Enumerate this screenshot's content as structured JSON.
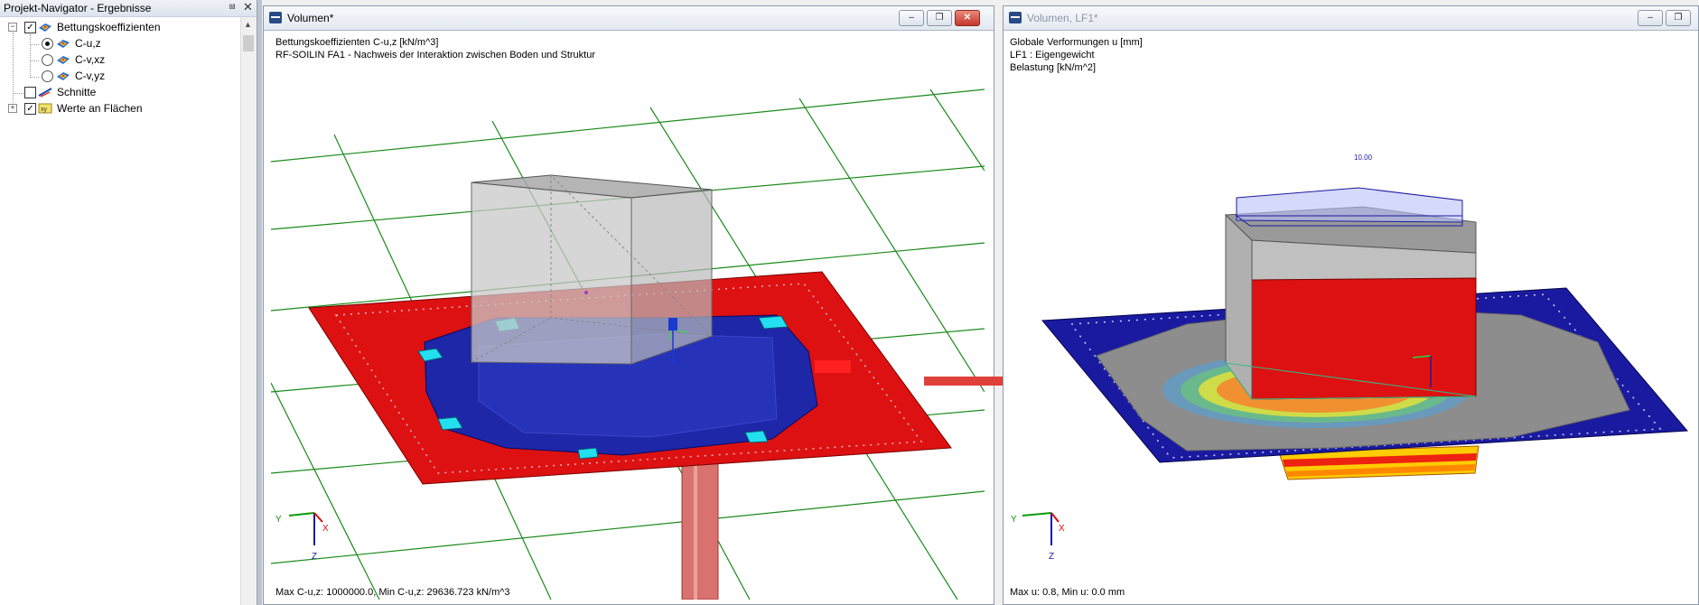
{
  "navigator": {
    "title": "Projekt-Navigator - Ergebnisse",
    "pin_icon": "pin-icon",
    "close_icon": "close-icon",
    "items": [
      {
        "label": "Bettungskoeffizienten",
        "checked": true,
        "expanded": true,
        "icon": "bedding-icon"
      },
      {
        "label": "C-u,z",
        "selected": true,
        "icon": "surface-result-icon"
      },
      {
        "label": "C-v,xz",
        "selected": false,
        "icon": "surface-result-icon"
      },
      {
        "label": "C-v,yz",
        "selected": false,
        "icon": "surface-result-icon"
      },
      {
        "label": "Schnitte",
        "checked": false,
        "icon": "section-icon"
      },
      {
        "label": "Werte an Flächen",
        "checked": true,
        "expanded": false,
        "icon": "values-icon"
      }
    ]
  },
  "window_left": {
    "title": "Volumen*",
    "info_line1": "Bettungskoeffizienten C-u,z [kN/m^3]",
    "info_line2": "RF-SOILIN FA1 - Nachweis der Interaktion zwischen Boden und Struktur",
    "status": "Max C-u,z: 1000000.0, Min C-u,z: 29636.723 kN/m^3",
    "axis_y": "Y",
    "axis_x": "X",
    "axis_z": "Z",
    "buttons": {
      "minimize": "minimize-icon",
      "restore": "restore-icon",
      "close": "close-icon"
    }
  },
  "window_right": {
    "title": "Volumen, LF1*",
    "info_line1": "Globale Verformungen u [mm]",
    "info_line2": "LF1 : Eigengewicht",
    "info_line3": "Belastung [kN/m^2]",
    "load_value": "10.00",
    "status": "Max u: 0.8, Min u: 0.0 mm",
    "axis_y": "Y",
    "axis_x": "X",
    "axis_z": "Z",
    "buttons": {
      "minimize": "minimize-icon",
      "restore": "restore-icon"
    }
  },
  "colors": {
    "red": "#dd1111",
    "blue": "#1a1aa0",
    "cyan": "#22e0f0",
    "gray_block": "#c8c8c8",
    "arrow": "#e0403a",
    "grid_green": "#1a8a1a"
  }
}
